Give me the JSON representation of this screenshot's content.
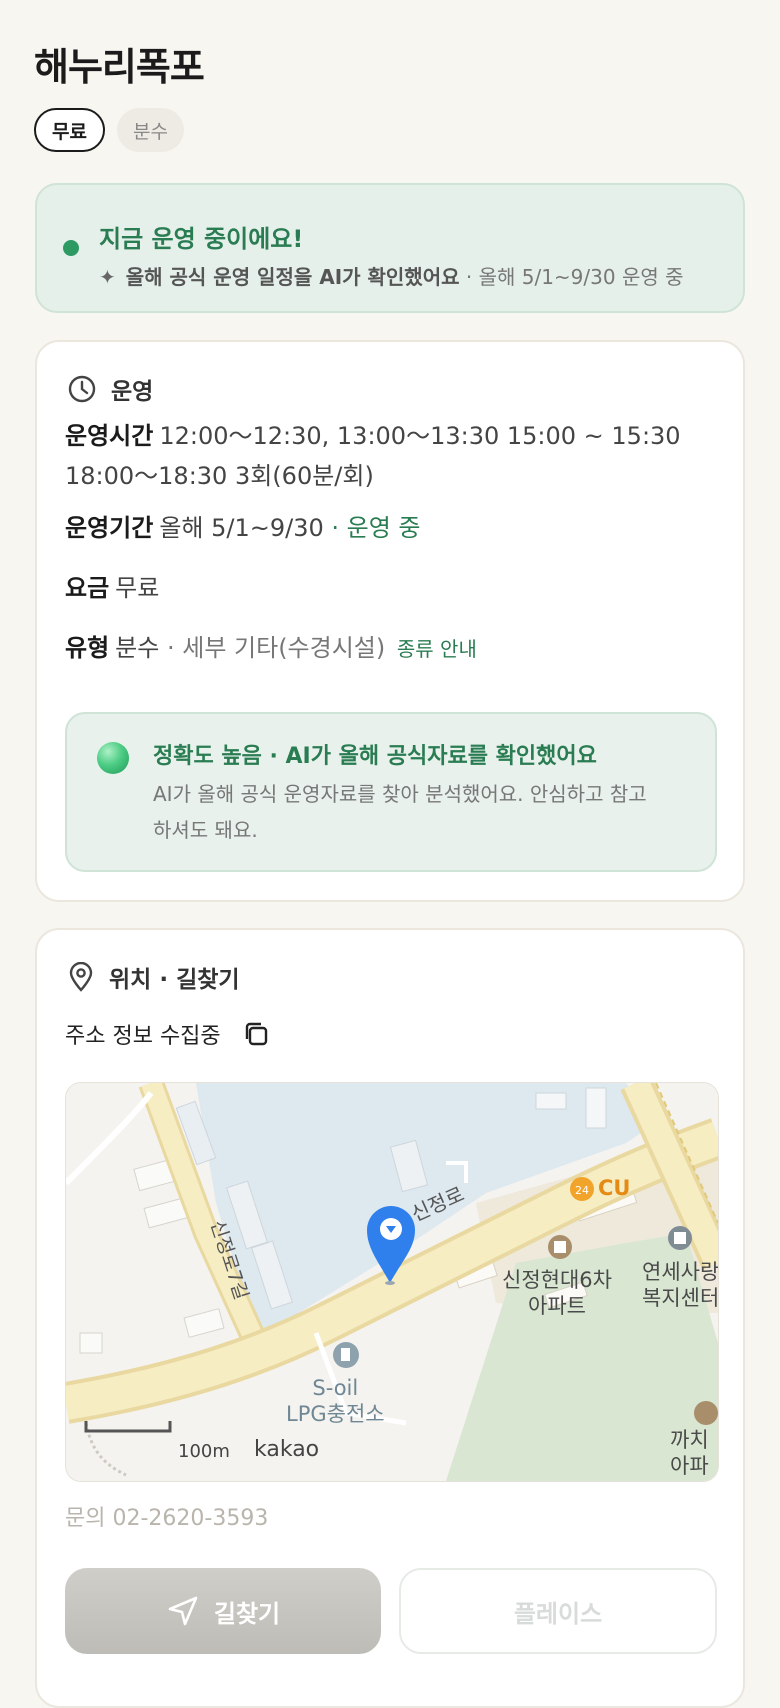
{
  "title": "해누리폭포",
  "chips": [
    {
      "label": "무료",
      "active": true
    },
    {
      "label": "분수",
      "active": false
    }
  ],
  "status": {
    "title": "지금 운영 중이에요!",
    "sub_strong": "올해 공식 운영 일정을 AI가 확인했어요",
    "sub_muted": "· 올해 5/1~9/30 운영 중"
  },
  "operation": {
    "heading": "운영",
    "hours_label": "운영시간",
    "hours_value": "12:00～12:30, 13:00～13:30 15:00 ~ 15:30 18:00～18:30 3회(60분/회)",
    "period_label": "운영기간",
    "period_value": "올해 5/1~9/30",
    "period_status": "· 운영 중",
    "fee_label": "요금",
    "fee_value": "무료",
    "type_label": "유형",
    "type_value": "분수",
    "type_detail": "· 세부 기타(수경시설)",
    "type_link": "종류 안내",
    "ai_title": "정확도 높음 · AI가 올해 공식자료를 확인했어요",
    "ai_desc": "AI가 올해 공식 운영자료를 찾아 분석했어요. 안심하고 참고하셔도 돼요."
  },
  "location": {
    "heading": "위치 · 길찾기",
    "address": "주소 정보 수집중",
    "map": {
      "road_main": "신정로",
      "road_side": "신정로7길",
      "poi_cu": "CU",
      "poi_apt": "신정현대6차 아파트",
      "poi_apt_line1": "신정현대6차",
      "poi_apt_line2": "아파트",
      "poi_welfare_line1": "연세사랑",
      "poi_welfare_line2": "복지센터",
      "poi_gas_line1": "S-oil",
      "poi_gas_line2": "LPG충전소",
      "poi_kkachi_line1": "까치",
      "poi_kkachi_line2": "아파",
      "scale": "100m",
      "brand": "kakao"
    },
    "phone": "문의 02-2620-3593",
    "route_button": "길찾기",
    "place_button": "플레이스"
  },
  "colors": {
    "accent_green": "#2a7c52",
    "status_bg": "#e6f0ea",
    "pin_blue": "#2f80ed"
  }
}
